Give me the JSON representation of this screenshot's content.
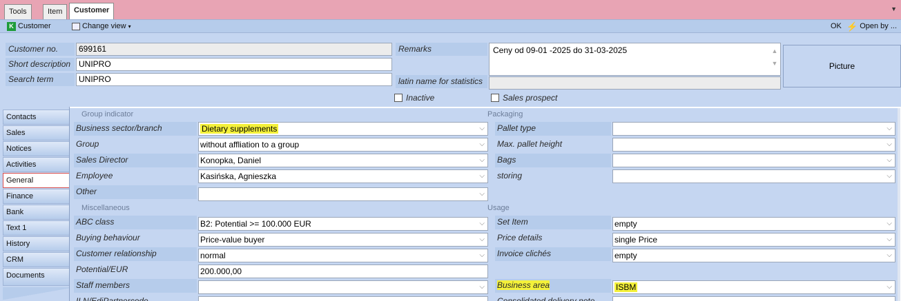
{
  "tabs": [
    {
      "label": "Tools"
    },
    {
      "label": "Item"
    },
    {
      "label": "Customer"
    }
  ],
  "toolbar": {
    "customer_label": "Customer",
    "customer_icon_letter": "K",
    "change_view_label": "Change view",
    "ok_label": "OK",
    "open_by_label": "Open by ..."
  },
  "header": {
    "customer_no_label": "Customer no.",
    "customer_no_value": "699161",
    "short_desc_label": "Short description",
    "short_desc_value": "UNIPRO",
    "search_term_label": "Search term",
    "search_term_value": "UNIPRO",
    "remarks_label": "Remarks",
    "remarks_value": "Ceny od 09-01 -2025 do 31-03-2025",
    "latin_name_label": "latin name for statistics",
    "latin_name_value": "",
    "picture_label": "Picture",
    "inactive_label": "Inactive",
    "sales_prospect_label": "Sales prospect"
  },
  "sidebar": {
    "items": [
      {
        "label": "Contacts"
      },
      {
        "label": "Sales"
      },
      {
        "label": "Notices"
      },
      {
        "label": "Activities"
      },
      {
        "label": "General"
      },
      {
        "label": "Finance"
      },
      {
        "label": "Bank"
      },
      {
        "label": "Text 1"
      },
      {
        "label": "History"
      },
      {
        "label": "CRM"
      },
      {
        "label": "Documents"
      }
    ],
    "active": "General"
  },
  "group_indicator": {
    "title": "Group indicator",
    "fields": [
      {
        "label": "Business sector/branch",
        "value": "Dietary supplements"
      },
      {
        "label": "Group",
        "value": "without affliation to a group"
      },
      {
        "label": "Sales Director",
        "value": "Konopka, Daniel"
      },
      {
        "label": "Employee",
        "value": "Kasińska, Agnieszka"
      },
      {
        "label": "Other",
        "value": ""
      }
    ]
  },
  "packaging": {
    "title": "Packaging",
    "fields": [
      {
        "label": "Pallet type",
        "value": ""
      },
      {
        "label": "Max. pallet height",
        "value": ""
      },
      {
        "label": "Bags",
        "value": ""
      },
      {
        "label": "storing",
        "value": ""
      }
    ]
  },
  "miscellaneous": {
    "title": "Miscellaneous",
    "fields": [
      {
        "label": "ABC class",
        "value": "B2: Potential >= 100.000 EUR"
      },
      {
        "label": "Buying behaviour",
        "value": "Price-value buyer"
      },
      {
        "label": "Customer relationship",
        "value": "normal"
      },
      {
        "label": "Potential/EUR",
        "value": "200.000,00"
      },
      {
        "label": "Staff members",
        "value": ""
      },
      {
        "label": "ILN/EdiPartnercode",
        "value": ""
      }
    ]
  },
  "usage": {
    "title": "Usage",
    "fields": [
      {
        "label": "Set Item",
        "value": "empty"
      },
      {
        "label": "Price details",
        "value": "single Price"
      },
      {
        "label": "Invoice clichés",
        "value": "empty"
      },
      {
        "label": "Business area",
        "value": "ISBM"
      },
      {
        "label": "Consolidated delivery note",
        "value": ""
      }
    ]
  },
  "colors": {
    "highlight": "#f4f13a",
    "panel": "#c5d6f1",
    "label_bg": "#b6cceb",
    "frame": "#e8a4b4"
  }
}
